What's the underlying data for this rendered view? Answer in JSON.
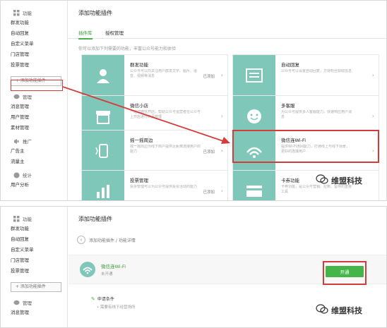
{
  "colors": {
    "accent": "#44b549",
    "highlight": "#d43c3c",
    "thumb": "#7fc7b8"
  },
  "sidebar": {
    "sections": [
      {
        "title": "功能",
        "icon": "grid-icon",
        "items": [
          "群发功能",
          "自动回复",
          "自定义菜单",
          "门店管理",
          "投票管理"
        ]
      },
      {
        "title": "管理",
        "icon": "chat-icon",
        "items": [
          "消息管理",
          "用户管理",
          "素材管理"
        ]
      },
      {
        "title": "推广",
        "icon": "megaphone-icon",
        "items": [
          "广告主",
          "流量主"
        ]
      },
      {
        "title": "统计",
        "icon": "chart-icon",
        "items": [
          "用户分析"
        ]
      }
    ],
    "add_label": "+ 添加功能插件"
  },
  "top": {
    "title": "添加功能插件",
    "tabs": [
      "插件库",
      "授权管理"
    ],
    "hint": "你可以添加下列需要的功能，丰富公众号能力和体验",
    "cards": [
      {
        "name": "群发功能",
        "desc": "公众号可以向关注用户群发文字、图片、语音、视频等消息",
        "status": "已添加",
        "icon": "user-icon"
      },
      {
        "name": "自动回复",
        "desc": "公众号可以设置自动回复，方便粉丝获取信息",
        "status": "",
        "icon": "message-box-icon"
      },
      {
        "name": "微信小店",
        "desc": "一站式微信开店，帮助公众号运营者在公众号上开店进行商品管理",
        "status": "",
        "icon": "shop-icon"
      },
      {
        "name": "多客服",
        "desc": "为公众号提供多人客服能力，快速响应用户消息",
        "status": "",
        "icon": "smile-icon"
      },
      {
        "name": "摇一摇周边",
        "desc": "摇一摇周边为线下商户提供近距离连接用户的能力",
        "status": "已添加",
        "icon": "shake-icon"
      },
      {
        "name": "微信连Wi-Fi",
        "desc": "提供Wi-Fi连网能力，打通线上与线下场景，更好的连接用户",
        "status": "",
        "icon": "wifi-icon"
      },
      {
        "name": "投票管理",
        "desc": "投票管理可以为公众号提供投票活动的能力",
        "status": "已添加",
        "icon": "bar-chart-icon"
      },
      {
        "name": "卡券功能",
        "desc": "卡券功能，是公众号营销、拉新、留存的重要工具",
        "status": "",
        "icon": "card-icon"
      }
    ]
  },
  "bottom": {
    "title": "添加功能插件",
    "breadcrumb": "添加功能插件 / 功能详情",
    "wifi_name": "微信连Wi-Fi",
    "wifi_status": "未开通",
    "open_label": "开通",
    "apply_title": "申请条件",
    "apply_desc": "• 需要有线下经营场所"
  },
  "watermark": "维盟科技"
}
